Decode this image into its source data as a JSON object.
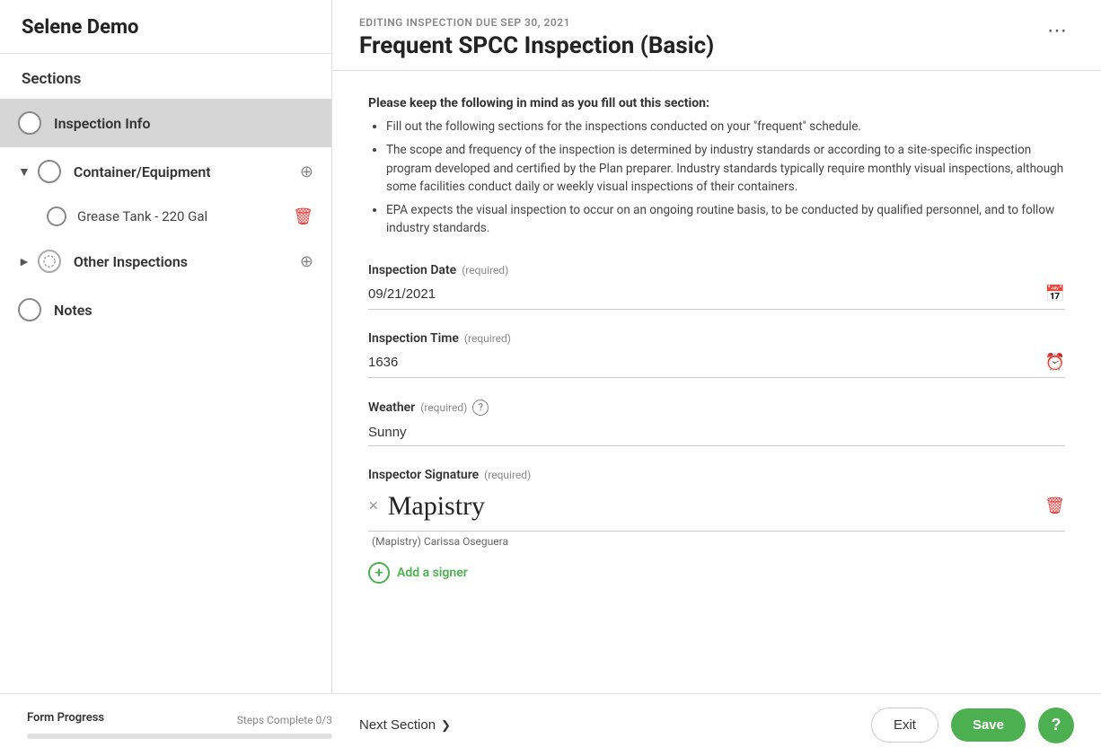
{
  "app": {
    "title": "Selene Demo"
  },
  "sidebar": {
    "sections_label": "Sections",
    "items": [
      {
        "id": "inspection-info",
        "label": "Inspection Info",
        "active": true,
        "has_check": false,
        "expandable": false,
        "has_add": false
      },
      {
        "id": "container-equipment",
        "label": "Container/Equipment",
        "active": false,
        "expandable": true,
        "expanded": true,
        "has_add": true,
        "subitems": [
          {
            "id": "grease-tank",
            "label": "Grease Tank - 220 Gal",
            "has_delete": true
          }
        ]
      },
      {
        "id": "other-inspections",
        "label": "Other Inspections",
        "active": false,
        "has_check": true,
        "checked": true,
        "expandable": true,
        "has_add": true
      },
      {
        "id": "notes",
        "label": "Notes",
        "active": false,
        "has_check": false,
        "expandable": false,
        "has_add": false
      }
    ]
  },
  "header": {
    "editing_label": "EDITING INSPECTION DUE SEP 30, 2021",
    "title": "Frequent SPCC Inspection (Basic)"
  },
  "instructions": {
    "bold": "Please keep the following in mind as you fill out this section:",
    "bullets": [
      "Fill out the following sections for the inspections conducted on your \"frequent\" schedule.",
      "The scope and frequency of the inspection is determined by industry standards or according to a site-specific inspection program developed and certified by the Plan preparer. Industry standards typically require monthly visual inspections, although some facilities conduct daily or weekly visual inspections of their containers.",
      "EPA expects the visual inspection to occur on an ongoing routine basis, to be conducted by qualified personnel, and to follow industry standards."
    ]
  },
  "form": {
    "inspection_date": {
      "label": "Inspection Date",
      "required": "(required)",
      "value": "09/21/2021",
      "placeholder": ""
    },
    "inspection_time": {
      "label": "Inspection Time",
      "required": "(required)",
      "value": "1636",
      "placeholder": ""
    },
    "weather": {
      "label": "Weather",
      "required": "(required)",
      "value": "Sunny",
      "placeholder": "",
      "has_help": true
    },
    "inspector_signature": {
      "label": "Inspector Signature",
      "required": "(required)",
      "signature_text": "Mapistry",
      "signature_name": "(Mapistry) Carissa Oseguera"
    },
    "add_signer_label": "Add a signer"
  },
  "footer": {
    "form_progress_label": "Form Progress",
    "steps_complete": "Steps Complete 0/3",
    "next_section_label": "Next Section",
    "exit_label": "Exit",
    "save_label": "Save",
    "help_icon": "?"
  }
}
